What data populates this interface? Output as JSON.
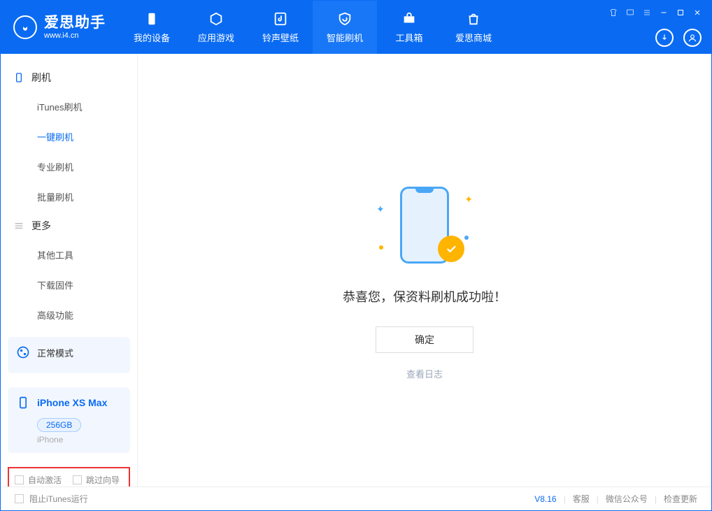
{
  "app": {
    "name_cn": "爱思助手",
    "url": "www.i4.cn"
  },
  "tabs": [
    {
      "label": "我的设备"
    },
    {
      "label": "应用游戏"
    },
    {
      "label": "铃声壁纸"
    },
    {
      "label": "智能刷机"
    },
    {
      "label": "工具箱"
    },
    {
      "label": "爱思商城"
    }
  ],
  "sidebar": {
    "section1_title": "刷机",
    "items1": [
      {
        "label": "iTunes刷机"
      },
      {
        "label": "一键刷机"
      },
      {
        "label": "专业刷机"
      },
      {
        "label": "批量刷机"
      }
    ],
    "section2_title": "更多",
    "items2": [
      {
        "label": "其他工具"
      },
      {
        "label": "下载固件"
      },
      {
        "label": "高级功能"
      }
    ]
  },
  "device": {
    "mode": "正常模式",
    "name": "iPhone XS Max",
    "capacity": "256GB",
    "type": "iPhone"
  },
  "bottom_options": {
    "auto_activate": "自动激活",
    "skip_wizard": "跳过向导"
  },
  "main": {
    "success_msg": "恭喜您，保资料刷机成功啦！",
    "confirm": "确定",
    "view_log": "查看日志"
  },
  "footer": {
    "block_itunes": "阻止iTunes运行",
    "version": "V8.16",
    "links": [
      "客服",
      "微信公众号",
      "检查更新"
    ]
  }
}
